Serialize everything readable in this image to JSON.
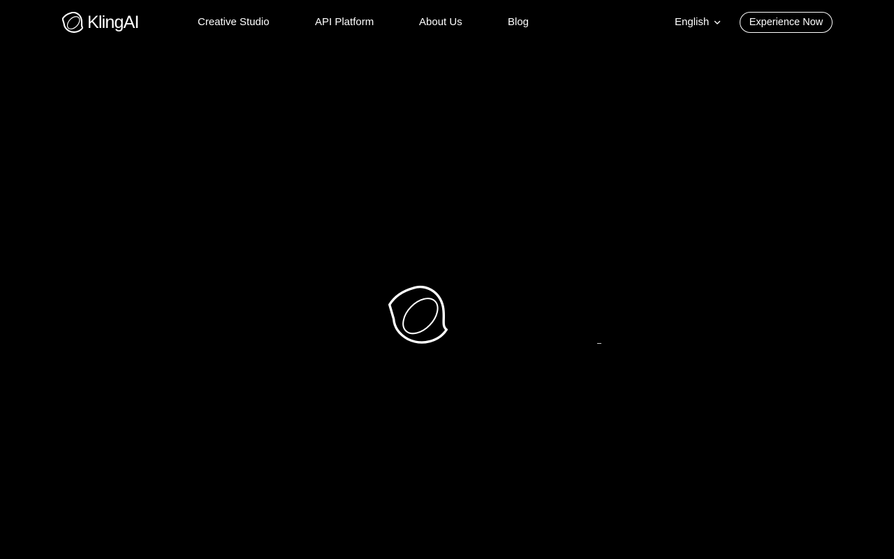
{
  "brand": {
    "name": "KlingAI",
    "icon": "kling-logo-icon"
  },
  "nav": {
    "items": [
      {
        "label": "Creative Studio"
      },
      {
        "label": "API Platform"
      },
      {
        "label": "About Us"
      },
      {
        "label": "Blog"
      }
    ]
  },
  "header": {
    "language": "English",
    "language_icon": "chevron-down-icon",
    "cta_label": "Experience Now"
  },
  "loader": {
    "icon": "kling-logo-icon"
  },
  "colors": {
    "background": "#000000",
    "foreground": "#ffffff"
  }
}
